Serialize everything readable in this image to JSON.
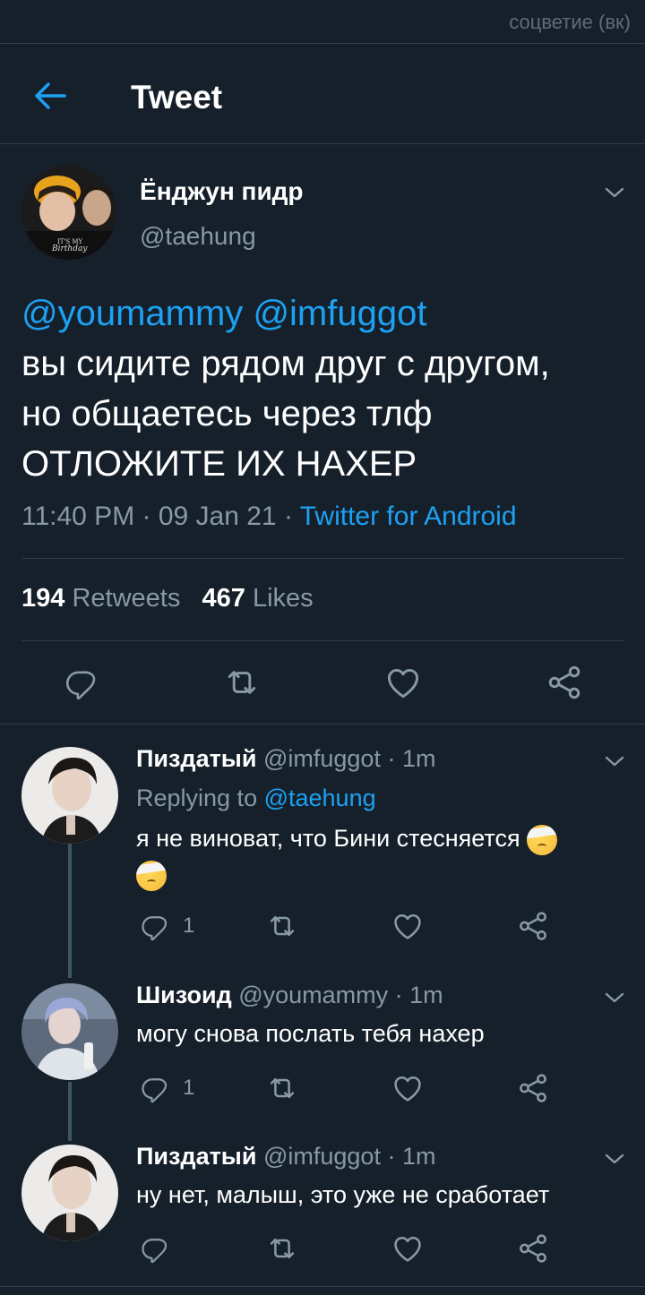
{
  "watermark": "соцветие (вк)",
  "header": {
    "title": "Tweet",
    "back_icon": "arrow-left-icon"
  },
  "colors": {
    "background": "#15202b",
    "accent": "#1da1f2",
    "muted": "#8899a6",
    "divider": "#2f3d4a"
  },
  "tweet": {
    "author_name": "Ёнджун пидр",
    "author_handle": "@taehung",
    "mention1": "@youmammy",
    "mention2": "@imfuggot",
    "line1": "вы сидите рядом друг с другом,",
    "line2": "но общаетесь через тлф",
    "line3": "ОТЛОЖИТЕ ИХ НАХЕР",
    "time": "11:40 PM · 09 Jan 21 · ",
    "source": "Twitter for Android",
    "retweets_count": "194",
    "retweets_label": "Retweets",
    "likes_count": "467",
    "likes_label": "Likes"
  },
  "replies": [
    {
      "name": "Пиздатый",
      "handle_time": "@imfuggot · 1m",
      "replying_prefix": "Replying to ",
      "replying_to": "@taehung",
      "text": "я не виноват, что Бини стесняется",
      "reply_count": "1"
    },
    {
      "name": "Шизоид",
      "handle_time": "@youmammy · 1m",
      "text": "могу снова послать тебя нахер",
      "reply_count": "1"
    },
    {
      "name": "Пиздатый",
      "handle_time": "@imfuggot · 1m",
      "text": "ну нет, малыш, это уже не сработает",
      "reply_count": ""
    }
  ]
}
